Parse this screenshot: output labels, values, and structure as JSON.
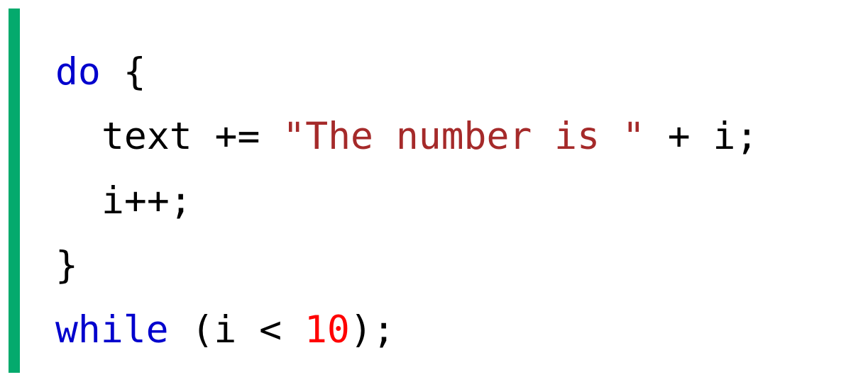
{
  "colors": {
    "accent_bar": "#04AA6D",
    "keyword": "#0000CD",
    "string": "#A52A2A",
    "number": "#FF0000",
    "default": "#000000"
  },
  "code": {
    "line1": {
      "keyword": "do",
      "rest": " {"
    },
    "line2": {
      "lhs": "text += ",
      "string": "\"The number is \"",
      "rhs": " + i;"
    },
    "line3": {
      "text": "i++;"
    },
    "line4": {
      "text": "}"
    },
    "line5": {
      "keyword": "while",
      "pre": " (i < ",
      "number": "10",
      "post": ");"
    }
  }
}
